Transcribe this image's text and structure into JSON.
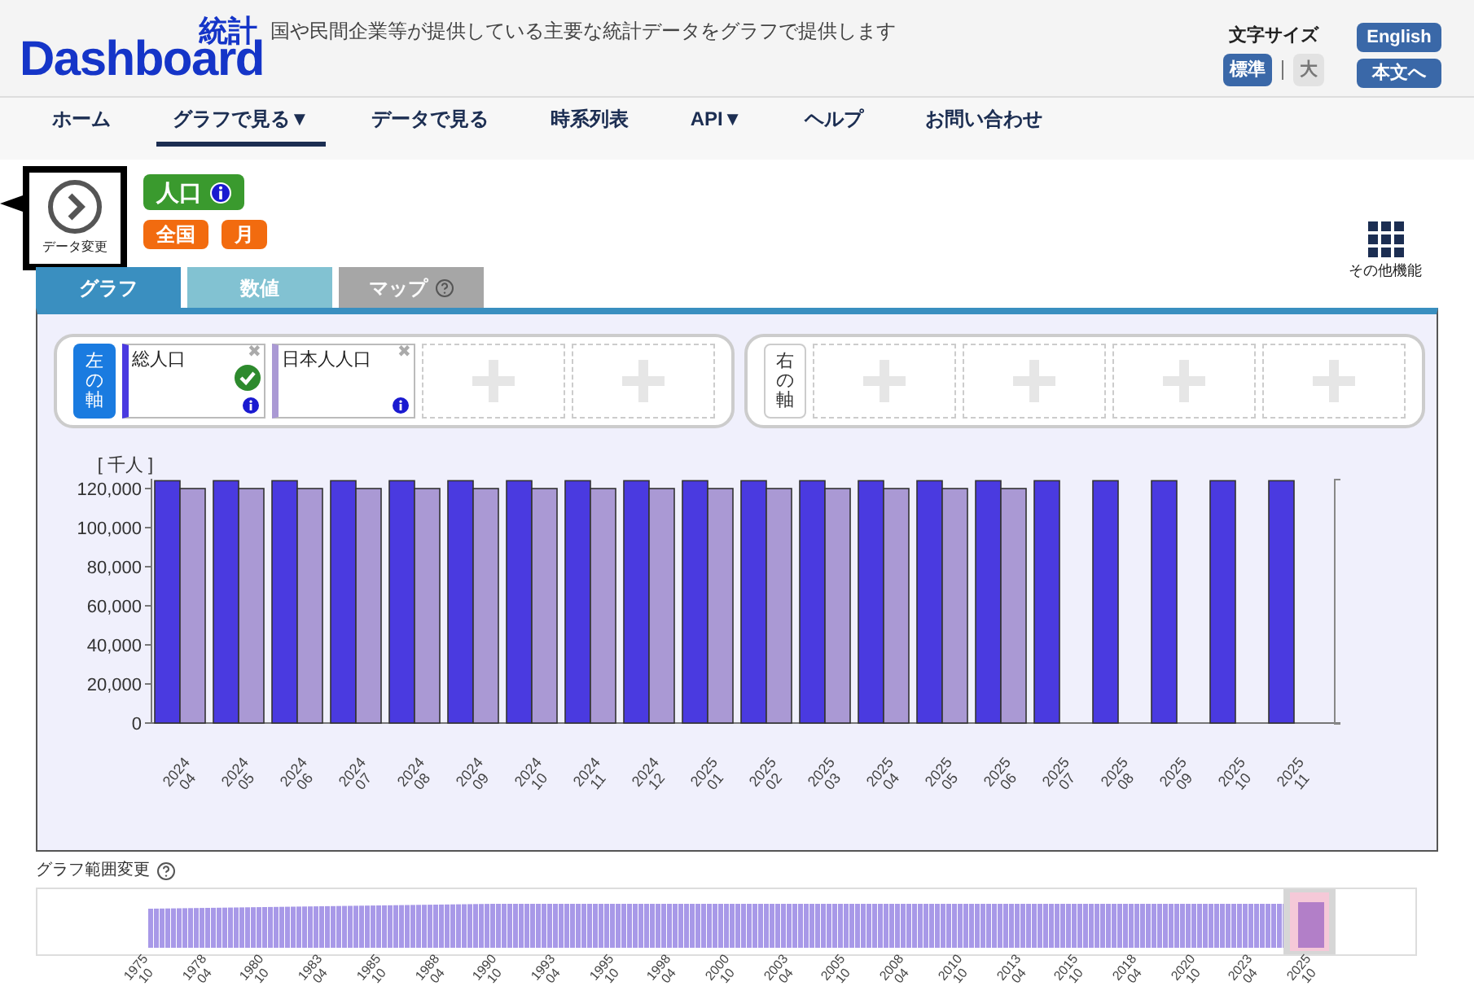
{
  "header": {
    "logo_text": "Dashboard",
    "logo_kanji": "統計",
    "tagline": "国や民間企業等が提供している主要な統計データをグラフで提供します",
    "font_size_label": "文字サイズ",
    "font_sizes": [
      {
        "label": "標準",
        "selected": true
      },
      {
        "label": "大",
        "selected": false
      }
    ],
    "buttons": [
      "English",
      "本文へ"
    ]
  },
  "nav": [
    {
      "label": "ホーム",
      "selected": false
    },
    {
      "label": "グラフで見る▼",
      "selected": true
    },
    {
      "label": "データで見る",
      "selected": false
    },
    {
      "label": "時系列表",
      "selected": false
    },
    {
      "label": "API▼",
      "selected": false
    },
    {
      "label": "ヘルプ",
      "selected": false
    },
    {
      "label": "お問い合わせ",
      "selected": false
    }
  ],
  "data_change": {
    "label": "データ変更"
  },
  "dataset": {
    "title": "人口",
    "tags": [
      "全国",
      "月"
    ]
  },
  "other_functions": {
    "label": "その他機能"
  },
  "tabs": [
    {
      "label": "グラフ",
      "selected": true,
      "disabled": false,
      "help": false
    },
    {
      "label": "数値",
      "selected": false,
      "disabled": false,
      "help": false
    },
    {
      "label": "マップ",
      "selected": false,
      "disabled": true,
      "help": true
    }
  ],
  "left_axis": {
    "label": "左の軸",
    "slots": [
      {
        "kind": "series",
        "checked": true,
        "remove": "✖"
      },
      {
        "kind": "series",
        "checked": false,
        "remove": "✖"
      },
      {
        "kind": "empty"
      },
      {
        "kind": "empty"
      }
    ]
  },
  "right_axis": {
    "label": "右の軸",
    "slots": [
      {
        "kind": "empty"
      },
      {
        "kind": "empty"
      },
      {
        "kind": "empty"
      },
      {
        "kind": "empty"
      }
    ]
  },
  "chart": {
    "chart_data": {
      "type": "bar",
      "ylabel": "[ 千人 ]",
      "categories": [
        "2024 04",
        "2024 05",
        "2024 06",
        "2024 07",
        "2024 08",
        "2024 09",
        "2024 10",
        "2024 11",
        "2024 12",
        "2025 01",
        "2025 02",
        "2025 03",
        "2025 04",
        "2025 05",
        "2025 06",
        "2025 07",
        "2025 08",
        "2025 09",
        "2025 10",
        "2025 11"
      ],
      "ylim": [
        0,
        125000
      ],
      "yticks": [
        {
          "value": 0,
          "label": "0"
        },
        {
          "value": 20000,
          "label": "20,000"
        },
        {
          "value": 40000,
          "label": "40,000"
        },
        {
          "value": 60000,
          "label": "60,000"
        },
        {
          "value": 80000,
          "label": "80,000"
        },
        {
          "value": 100000,
          "label": "100,000"
        },
        {
          "value": 120000,
          "label": "120,000"
        }
      ],
      "series": [
        {
          "name": "総人口",
          "color": "#4a3ae0",
          "values": [
            124000,
            124000,
            124000,
            124000,
            124000,
            124000,
            124000,
            124000,
            124000,
            124000,
            124000,
            124000,
            124000,
            124000,
            124000,
            124000,
            124000,
            124000,
            124000,
            124000
          ]
        },
        {
          "name": "日本人人口",
          "color": "#aa99d4",
          "values": [
            120000,
            120000,
            120000,
            120000,
            120000,
            120000,
            120000,
            120000,
            120000,
            120000,
            120000,
            120000,
            120000,
            120000,
            120000,
            null,
            null,
            null,
            null,
            null
          ]
        }
      ]
    }
  },
  "range": {
    "label": "グラフ範囲変更",
    "ticks": [
      "1975 10",
      "1978 04",
      "1980 10",
      "1983 04",
      "1985 10",
      "1988 04",
      "1990 10",
      "1993 04",
      "1995 10",
      "1998 04",
      "2000 10",
      "2003 04",
      "2005 10",
      "2008 04",
      "2010 10",
      "2013 04",
      "2015 10",
      "2018 04",
      "2020 10",
      "2023 04",
      "2025 10"
    ]
  }
}
